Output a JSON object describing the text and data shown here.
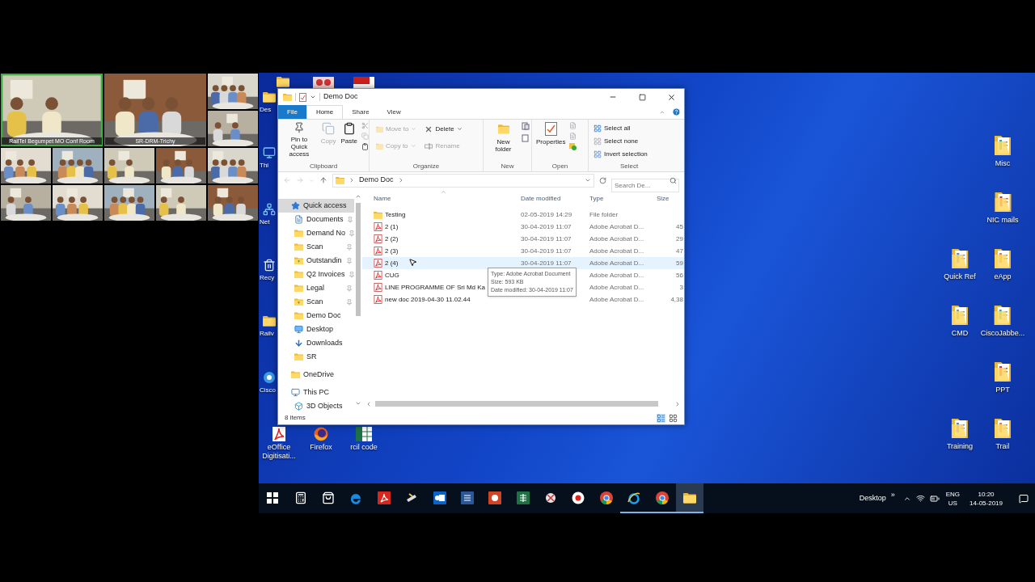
{
  "video_conference": {
    "tiles": [
      {
        "kind": "large",
        "active": true,
        "caption": "RailTel Begumpet MO Conf Room"
      },
      {
        "kind": "large",
        "active": false,
        "caption": "SR-DRM-Trichy"
      },
      {
        "kind": "small",
        "active": false
      },
      {
        "kind": "small",
        "active": false
      },
      {
        "kind": "small",
        "active": false
      },
      {
        "kind": "small",
        "active": false
      },
      {
        "kind": "small",
        "active": false
      },
      {
        "kind": "small",
        "active": false
      },
      {
        "kind": "small",
        "active": false
      },
      {
        "kind": "small",
        "active": false
      },
      {
        "kind": "small",
        "active": false
      },
      {
        "kind": "small",
        "active": false
      },
      {
        "kind": "small",
        "active": false
      },
      {
        "kind": "small",
        "active": false
      }
    ]
  },
  "desktop": {
    "left_icons": [
      {
        "label": "Des",
        "kind": "folder"
      },
      {
        "label": "Thi",
        "kind": "pc"
      },
      {
        "label": "Net",
        "kind": "network"
      },
      {
        "label": "Recy",
        "kind": "recycle"
      },
      {
        "label": "Railv",
        "kind": "folder"
      },
      {
        "label": "Cisco",
        "kind": "app"
      }
    ],
    "bottom_icons": [
      {
        "label": "eOffice Digitisati...",
        "kind": "pdf"
      },
      {
        "label": "Firefox",
        "kind": "firefox"
      },
      {
        "label": "rcil code",
        "kind": "sheet"
      }
    ],
    "right_icons": [
      {
        "label": "Misc"
      },
      {
        "label": "NIC mails"
      },
      {
        "label": "Quick Ref"
      },
      {
        "label": "eApp"
      },
      {
        "label": "CMD"
      },
      {
        "label": "CiscoJabbe..."
      },
      {
        "label": "PPT"
      },
      {
        "label": "Training"
      },
      {
        "label": "Trail"
      }
    ]
  },
  "explorer": {
    "title": "Demo Doc",
    "tabs": [
      {
        "label": "File",
        "kind": "file",
        "selected": false
      },
      {
        "label": "Home",
        "kind": "tab",
        "selected": true
      },
      {
        "label": "Share",
        "kind": "tab",
        "selected": false
      },
      {
        "label": "View",
        "kind": "tab",
        "selected": false
      }
    ],
    "ribbon": {
      "clipboard": {
        "label": "Clipboard",
        "pin": {
          "label": "Pin to Quick access",
          "disabled": false
        },
        "copy": {
          "label": "Copy",
          "disabled": true
        },
        "paste": {
          "label": "Paste",
          "disabled": false
        }
      },
      "organize": {
        "label": "Organize",
        "move_to": {
          "label": "Move to",
          "disabled": true
        },
        "copy_to": {
          "label": "Copy to",
          "disabled": true
        },
        "delete": {
          "label": "Delete",
          "disabled": false
        },
        "rename": {
          "label": "Rename",
          "disabled": true
        }
      },
      "new": {
        "label": "New",
        "new_folder": {
          "label": "New folder"
        }
      },
      "open": {
        "label": "Open",
        "properties": {
          "label": "Properties"
        }
      },
      "select": {
        "label": "Select",
        "select_all": {
          "label": "Select all"
        },
        "select_none": {
          "label": "Select none"
        },
        "invert_selection": {
          "label": "Invert selection"
        }
      }
    },
    "address": {
      "path": "Demo Doc",
      "search_placeholder": "Search De..."
    },
    "navigation": [
      {
        "label": "Quick access",
        "kind": "quick",
        "selected": true,
        "children": [
          {
            "label": "Documents",
            "kind": "docs",
            "pinned": true,
            "selected": false
          },
          {
            "label": "Demand No",
            "kind": "folder",
            "pinned": true,
            "selected": false
          },
          {
            "label": "Scan",
            "kind": "folder",
            "pinned": true,
            "selected": false
          },
          {
            "label": "Outstandin",
            "kind": "folder_sync",
            "pinned": true,
            "selected": false
          },
          {
            "label": "Q2 Invoices",
            "kind": "folder",
            "pinned": true,
            "selected": false
          },
          {
            "label": "Legal",
            "kind": "folder",
            "pinned": true,
            "selected": false
          },
          {
            "label": "Scan",
            "kind": "folder_sync",
            "pinned": true,
            "selected": false
          },
          {
            "label": "Demo Doc",
            "kind": "folder",
            "pinned": false,
            "selected": false
          },
          {
            "label": "Desktop",
            "kind": "desktop",
            "pinned": false,
            "selected": false
          },
          {
            "label": "Downloads",
            "kind": "download",
            "pinned": false,
            "selected": false
          },
          {
            "label": "SR",
            "kind": "folder",
            "pinned": false,
            "selected": false
          }
        ]
      },
      {
        "label": "OneDrive",
        "kind": "folder",
        "selected": false
      },
      {
        "label": "This PC",
        "kind": "pc",
        "selected": false,
        "children": [
          {
            "label": "3D Objects",
            "kind": "cube",
            "pinned": false,
            "selected": false
          }
        ]
      }
    ],
    "columns": [
      "Name",
      "Date modified",
      "Type",
      "Size"
    ],
    "files": [
      {
        "name": "Testing",
        "kind": "folder",
        "date": "02-05-2019 14:29",
        "type": "File folder",
        "hovered": false
      },
      {
        "name": "2 (1)",
        "kind": "pdf",
        "date": "30-04-2019 11:07",
        "type": "Adobe Acrobat D...",
        "size": "45",
        "hovered": false
      },
      {
        "name": "2 (2)",
        "kind": "pdf",
        "date": "30-04-2019 11:07",
        "type": "Adobe Acrobat D...",
        "size": "29",
        "hovered": false
      },
      {
        "name": "2 (3)",
        "kind": "pdf",
        "date": "30-04-2019 11:07",
        "type": "Adobe Acrobat D...",
        "size": "47",
        "hovered": false
      },
      {
        "name": "2 (4)",
        "kind": "pdf",
        "date": "30-04-2019 11:07",
        "type": "Adobe Acrobat D...",
        "size": "59",
        "hovered": true
      },
      {
        "name": "CUG",
        "kind": "pdf",
        "type": "Adobe Acrobat D...",
        "size": "56",
        "hovered": false
      },
      {
        "name": "LINE PROGRAMME OF Sri Md Ka",
        "kind": "pdf",
        "type": "Adobe Acrobat D...",
        "size": "3",
        "hovered": false
      },
      {
        "name": "new doc 2019-04-30 11.02.44",
        "kind": "pdf",
        "type": "Adobe Acrobat D...",
        "size": "4,38",
        "hovered": false
      }
    ],
    "tooltip": [
      "Type: Adobe Acrobat Document",
      "Size: 593 KB",
      "Date modified: 30-04-2019 11:07"
    ],
    "status": "8 items"
  },
  "taskbar": {
    "apps": [
      {
        "kind": "start",
        "running": false,
        "selected": false
      },
      {
        "kind": "calculator",
        "running": false,
        "selected": false
      },
      {
        "kind": "store",
        "running": false,
        "selected": false
      },
      {
        "kind": "edge",
        "running": false,
        "selected": false
      },
      {
        "kind": "acrobat",
        "running": false,
        "selected": false
      },
      {
        "kind": "scanner",
        "running": false,
        "selected": false
      },
      {
        "kind": "outlook",
        "running": false,
        "selected": false
      },
      {
        "kind": "word",
        "running": false,
        "selected": false
      },
      {
        "kind": "powerpoint",
        "running": false,
        "selected": false
      },
      {
        "kind": "excel",
        "running": false,
        "selected": false
      },
      {
        "kind": "snip",
        "running": false,
        "selected": false
      },
      {
        "kind": "record",
        "running": false,
        "selected": false
      },
      {
        "kind": "chrome",
        "running": false,
        "selected": false
      },
      {
        "kind": "ie",
        "running": true,
        "selected": false
      },
      {
        "kind": "chrome",
        "running": true,
        "selected": false
      },
      {
        "kind": "explorer",
        "running": true,
        "selected": true
      }
    ],
    "toolbar_label": "Desktop",
    "toolbar_chevron": "»",
    "language": "ENG",
    "region": "US",
    "time": "10:20",
    "date": "14-05-2019"
  }
}
